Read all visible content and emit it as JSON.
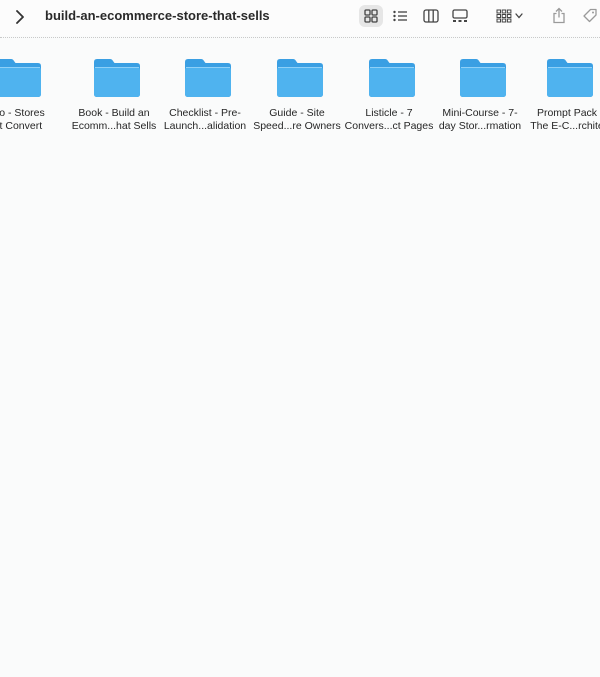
{
  "window": {
    "title": "build-an-ecommerce-store-that-sells"
  },
  "toolbar": {
    "back_icon": "chevron-right-icon",
    "view_modes": [
      "icon-view-icon",
      "list-view-icon",
      "column-view-icon",
      "gallery-view-icon"
    ],
    "active_view": "icon",
    "group_icon": "group-grid-icon",
    "share_icon": "share-icon",
    "tag_icon": "tag-icon"
  },
  "folders": [
    {
      "line1": "udio - Stores",
      "line2": "hat Convert"
    },
    {
      "line1": "Book - Build an",
      "line2": "Ecomm...hat Sells"
    },
    {
      "line1": "Checklist - Pre-",
      "line2": "Launch...alidation"
    },
    {
      "line1": "Guide - Site",
      "line2": "Speed...re Owners"
    },
    {
      "line1": "Listicle - 7",
      "line2": "Convers...ct Pages"
    },
    {
      "line1": "Mini-Course - 7-",
      "line2": "day Stor...rmation"
    },
    {
      "line1": "Prompt Pack",
      "line2": "The E-C...rchite"
    }
  ],
  "colors": {
    "folder_top": "#5db8ef",
    "folder_bottom": "#2f9be0",
    "background": "#fafbfb"
  }
}
